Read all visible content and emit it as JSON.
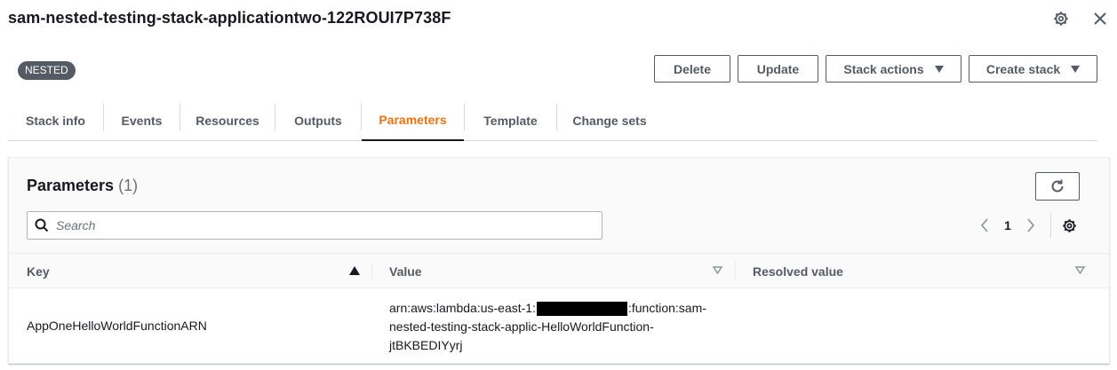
{
  "header": {
    "title": "sam-nested-testing-stack-applicationtwo-122ROUI7P738F",
    "badge": "NESTED"
  },
  "actions": {
    "delete": "Delete",
    "update": "Update",
    "stack_actions": "Stack actions",
    "create_stack": "Create stack"
  },
  "tabs": [
    {
      "label": "Stack info"
    },
    {
      "label": "Events"
    },
    {
      "label": "Resources"
    },
    {
      "label": "Outputs"
    },
    {
      "label": "Parameters",
      "active": true
    },
    {
      "label": "Template"
    },
    {
      "label": "Change sets"
    }
  ],
  "panel": {
    "title": "Parameters",
    "count": "(1)",
    "search_placeholder": "Search",
    "current_page": "1"
  },
  "table": {
    "columns": [
      "Key",
      "Value",
      "Resolved value"
    ],
    "rows": [
      {
        "key": "AppOneHelloWorldFunctionARN",
        "value_prefix": "arn:aws:lambda:us-east-1:",
        "value_line1_suffix": ":function:sam-",
        "value_line2": "nested-testing-stack-applic-HelloWorldFunction-",
        "value_line3": "jtBKBEDIYyrj",
        "resolved_value": ""
      }
    ]
  },
  "colors": {
    "active_tab": "#ec7211",
    "badge_bg": "#545b64",
    "border": "#d5dbdb"
  },
  "icons": [
    "gear-icon",
    "close-icon",
    "caret-down-icon",
    "refresh-icon",
    "search-icon",
    "chevron-left-icon",
    "chevron-right-icon",
    "sort-up-icon",
    "sort-down-icon"
  ]
}
